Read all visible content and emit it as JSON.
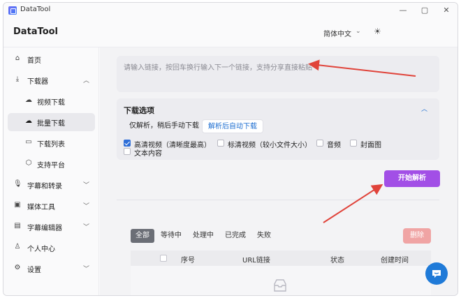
{
  "window": {
    "title": "DataTool",
    "controls": {
      "minimize": "—",
      "maximize": "▢",
      "close": "✕"
    }
  },
  "header": {
    "brand": "DataTool",
    "language": "简体中文",
    "theme_icon": "sun-icon"
  },
  "sidebar": {
    "items": [
      {
        "label": "首页",
        "icon": "home-icon",
        "sub": false,
        "active": false
      },
      {
        "label": "下载器",
        "icon": "download-icon",
        "sub": false,
        "active": false,
        "expanded": true
      },
      {
        "label": "视频下载",
        "icon": "cloud-download-icon",
        "sub": true,
        "active": false
      },
      {
        "label": "批量下载",
        "icon": "cloud-batch-icon",
        "sub": true,
        "active": true
      },
      {
        "label": "下载列表",
        "icon": "archive-icon",
        "sub": true,
        "active": false
      },
      {
        "label": "支持平台",
        "icon": "box-icon",
        "sub": true,
        "active": false
      },
      {
        "label": "字幕和转录",
        "icon": "mic-icon",
        "sub": false,
        "active": false
      },
      {
        "label": "媒体工具",
        "icon": "video-icon",
        "sub": false,
        "active": false
      },
      {
        "label": "字幕编辑器",
        "icon": "subtitle-icon",
        "sub": false,
        "active": false
      },
      {
        "label": "个人中心",
        "icon": "user-icon",
        "sub": false,
        "active": false
      },
      {
        "label": "设置",
        "icon": "gear-icon",
        "sub": false,
        "active": false
      }
    ]
  },
  "main": {
    "url_input": {
      "placeholder": "请输入链接，按回车换行输入下一个链接，支持分享直接粘贴"
    },
    "options": {
      "title": "下载选项",
      "mode_manual": "仅解析，稍后手动下载",
      "mode_auto": "解析后自动下载",
      "checkboxes": [
        {
          "label": "高清视频（清晰度最高）",
          "checked": true
        },
        {
          "label": "标清视频（较小文件大小）",
          "checked": false
        },
        {
          "label": "音频",
          "checked": false
        },
        {
          "label": "封面图",
          "checked": false
        },
        {
          "label": "文本内容",
          "checked": false
        }
      ]
    },
    "start_button": "开始解析",
    "status_tabs": [
      "全部",
      "等待中",
      "处理中",
      "已完成",
      "失败"
    ],
    "delete_button": "删除",
    "table_headers": {
      "index": "序号",
      "url": "URL链接",
      "status": "状态",
      "created": "创建时间"
    }
  },
  "colors": {
    "accent": "#a24fe6",
    "primary": "#1f6fd1",
    "delete": "#f0a4a4",
    "arrow": "#e0433a"
  }
}
